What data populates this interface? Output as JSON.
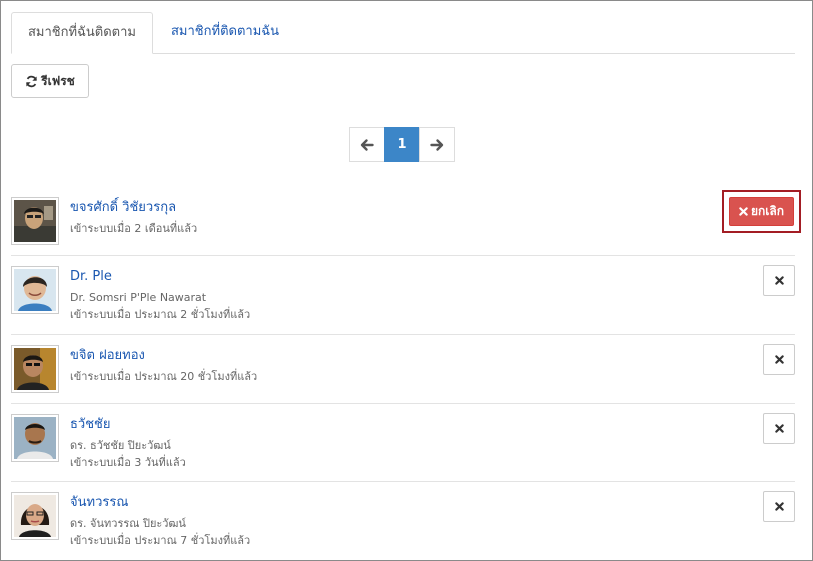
{
  "tabs": [
    {
      "label": "สมาชิกที่ฉันติดตาม",
      "active": true
    },
    {
      "label": "สมาชิกที่ติดตามฉัน",
      "active": false
    }
  ],
  "toolbar": {
    "refresh_label": "รีเฟรช",
    "refresh_icon": "refresh-icon"
  },
  "pagination": {
    "prev_icon": "arrow-left-icon",
    "current_page": "1",
    "next_icon": "arrow-right-icon"
  },
  "members": [
    {
      "name": "ขจรศักดิ์ วิชัยวรกุล",
      "subtitle": "",
      "last_login": "เข้าระบบเมื่อ 2 เดือนที่แล้ว",
      "action": "ยกเลิก",
      "highlighted": true
    },
    {
      "name": "Dr. Ple",
      "subtitle": "Dr. Somsri P'Ple Nawarat",
      "last_login": "เข้าระบบเมื่อ ประมาณ 2 ชั่วโมงที่แล้ว",
      "action": "",
      "highlighted": false
    },
    {
      "name": "ขจิต ฝอยทอง",
      "subtitle": "",
      "last_login": "เข้าระบบเมื่อ ประมาณ 20 ชั่วโมงที่แล้ว",
      "action": "",
      "highlighted": false
    },
    {
      "name": "ธวัชชัย",
      "subtitle": "ดร. ธวัชชัย ปิยะวัฒน์",
      "last_login": "เข้าระบบเมื่อ 3 วันที่แล้ว",
      "action": "",
      "highlighted": false
    },
    {
      "name": "จันทวรรณ",
      "subtitle": "ดร. จันทวรรณ ปิยะวัฒน์",
      "last_login": "เข้าระบบเมื่อ ประมาณ 7 ชั่วโมงที่แล้ว",
      "action": "",
      "highlighted": false
    }
  ],
  "colors": {
    "link": "#1a57b0",
    "danger": "#d9534f",
    "primary": "#3c86c8",
    "highlight_border": "#a31d24"
  }
}
